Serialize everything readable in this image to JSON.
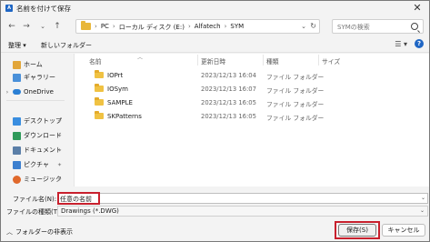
{
  "title": "名前を付けて保存",
  "nav": {
    "breadcrumbs": [
      "PC",
      "ローカル ディスク (E:)",
      "Alfatech",
      "SYM"
    ],
    "search_placeholder": "SYMの検索"
  },
  "toolbar": {
    "organize": "整理 ▾",
    "new_folder": "新しいフォルダー"
  },
  "sidebar": {
    "items": [
      {
        "label": "ホーム",
        "icon": "home-icon"
      },
      {
        "label": "ギャラリー",
        "icon": "gallery-icon"
      },
      {
        "label": "OneDrive",
        "icon": "onedrive-icon"
      },
      {
        "label": "デスクトップ",
        "icon": "desktop-icon"
      },
      {
        "label": "ダウンロード",
        "icon": "download-icon"
      },
      {
        "label": "ドキュメント",
        "icon": "documents-icon"
      },
      {
        "label": "ピクチャ",
        "icon": "pictures-icon"
      },
      {
        "label": "ミュージック",
        "icon": "music-icon"
      }
    ]
  },
  "columns": {
    "name": "名前",
    "date": "更新日時",
    "type": "種類",
    "size": "サイズ"
  },
  "files": [
    {
      "name": "IOPrt",
      "date": "2023/12/13 16:04",
      "type": "ファイル フォルダー"
    },
    {
      "name": "IOSym",
      "date": "2023/12/13 16:07",
      "type": "ファイル フォルダー"
    },
    {
      "name": "SAMPLE",
      "date": "2023/12/13 16:05",
      "type": "ファイル フォルダー"
    },
    {
      "name": "SKPatterns",
      "date": "2023/12/13 16:05",
      "type": "ファイル フォルダー"
    }
  ],
  "form": {
    "filename_label": "ファイル名(N):",
    "filename_value": "任意の名前",
    "filetype_label": "ファイルの種類(T):",
    "filetype_value": "Drawings (*.DWG)"
  },
  "footer": {
    "hide_folders": "フォルダーの非表示",
    "save": "保存(S)",
    "cancel": "キャンセル"
  },
  "colors": {
    "highlight": "#c8202d",
    "folder": "#f0c243",
    "accent": "#1f66c4"
  }
}
